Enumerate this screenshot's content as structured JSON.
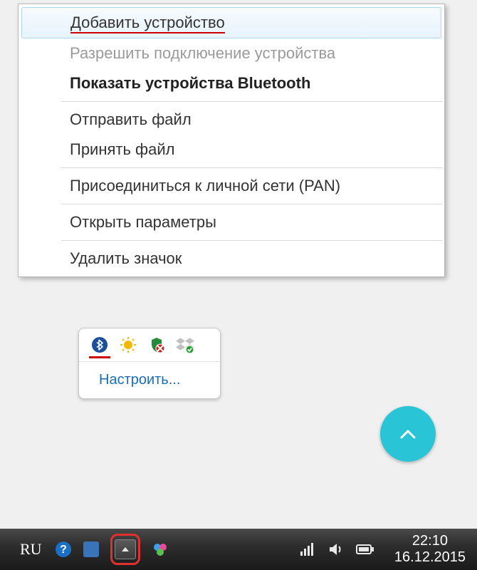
{
  "menu": {
    "items": [
      {
        "label": "Добавить устройство",
        "highlighted": true,
        "disabled": false,
        "bold": false
      },
      {
        "label": "Разрешить подключение устройства",
        "highlighted": false,
        "disabled": true,
        "bold": false
      },
      {
        "label": "Показать устройства Bluetooth",
        "highlighted": false,
        "disabled": false,
        "bold": true
      },
      {
        "separator": true
      },
      {
        "label": "Отправить файл",
        "highlighted": false,
        "disabled": false,
        "bold": false
      },
      {
        "label": "Принять файл",
        "highlighted": false,
        "disabled": false,
        "bold": false
      },
      {
        "separator": true
      },
      {
        "label": "Присоединиться к личной сети (PAN)",
        "highlighted": false,
        "disabled": false,
        "bold": false
      },
      {
        "separator": true
      },
      {
        "label": "Открыть параметры",
        "highlighted": false,
        "disabled": false,
        "bold": false
      },
      {
        "separator": true
      },
      {
        "label": "Удалить значок",
        "highlighted": false,
        "disabled": false,
        "bold": false
      }
    ]
  },
  "trayPopup": {
    "customizeLabel": "Настроить...",
    "icons": [
      {
        "name": "bluetooth-icon",
        "selected": true
      },
      {
        "name": "sun-icon"
      },
      {
        "name": "shield-alert-icon"
      },
      {
        "name": "dropbox-icon"
      }
    ]
  },
  "taskbar": {
    "lang": "RU",
    "time": "22:10",
    "date": "16.12.2015"
  }
}
